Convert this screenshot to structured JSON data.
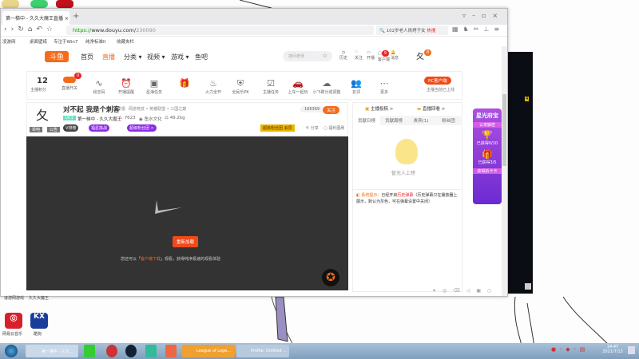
{
  "browser": {
    "tab_title": "第一梯中 - 久久大魔王直播",
    "new_tab": "+",
    "url_prefix": "https://",
    "url_domain": "www.douyu.com/",
    "url_path": "230090",
    "search_text": "102岁老人烘烤子女",
    "hot_label": "热搜",
    "bookmarks": [
      "凌游网",
      "桌面壁纸",
      "专注于Win7",
      "纯净标准II",
      "收藏夹栏"
    ]
  },
  "header": {
    "nav": [
      "首页",
      "直播",
      "分类 ▾",
      "视频 ▾",
      "游戏 ▾",
      "鱼吧"
    ],
    "active_nav": "直播",
    "search_placeholder": "搜问老师",
    "icons": [
      "历史",
      "关注",
      "开播",
      "客户端",
      "消息"
    ],
    "client_badge": "9",
    "avatar_badge": "8"
  },
  "toolbar": {
    "score": "12",
    "score_label": "主播积分",
    "items": [
      "直播开关",
      "绘志码",
      "开播提醒",
      "星海任务",
      "",
      "火力全开",
      "全民乐PK",
      "主播任务",
      "上车一起玩",
      "小飞碟分成调整",
      "友邻",
      "更多"
    ],
    "switch_badge": "0",
    "pc_client": "PC客户端",
    "pc_status": "主播当前已上线"
  },
  "room": {
    "title": "对不起 我是个刺客",
    "report": "举报",
    "category": "网游竞技 • 英雄联盟 • 三国之巅",
    "level": "LV.1",
    "streamer": "第一梯中 - 久久大魔王",
    "heat": "7623",
    "org": "鱼水文化",
    "weight": "49.2kg",
    "followers": "166369",
    "follow": "关注",
    "avatar_labels": [
      "举吧",
      "公告"
    ],
    "badges": [
      "V排榜",
      "福星挑战",
      "超级粉丝团 >"
    ],
    "banner": "超级粉丝团 会员",
    "share": "分享",
    "report2": "福利图刷"
  },
  "video": {
    "reload": "重新加载",
    "hint_pre": "您还可以「",
    "hint_link": "客户端下载",
    "hint_post": "」观看，获得纯净极速的观看体验"
  },
  "right_panel": {
    "links": [
      "主播投稿 >",
      "直播回看 >"
    ],
    "tabs": [
      "贡献日榜",
      "贡献周榜",
      "贵宾(1)",
      "粉丝团"
    ],
    "empty": "暂无人上榜",
    "sys_label": "系统提示：",
    "sys_text": "已经开启",
    "sys_link": "历史弹幕",
    "sys_rest": "（历史弹幕只在播放器上展示，默认为灰色，可在弹幕设置中关闭）"
  },
  "promo": {
    "title": "星光府宝",
    "sub": "认宠解密",
    "item1": "已获得0/10",
    "item2": "已获得3/5",
    "btn": "获得拆卡卡"
  },
  "desktop": {
    "labels": [
      "凌游网游戏",
      "久久大魔王",
      "网易云音乐",
      "酷狗"
    ]
  },
  "taskbar": {
    "items": [
      "第一梯中 - 久久...",
      "League of Lege...",
      "Profile: Untitled ..."
    ],
    "time": "14:47",
    "date": "2021/7/13",
    "black_badge": "4"
  }
}
